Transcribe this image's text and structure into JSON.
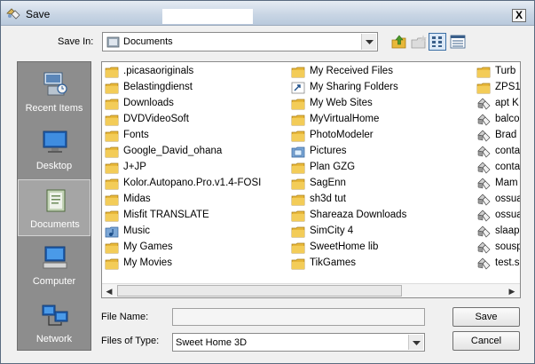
{
  "window": {
    "title": "Save",
    "close_label": "X"
  },
  "save_in": {
    "label": "Save In:",
    "value": "Documents"
  },
  "toolbar_icons": [
    "up-folder-icon",
    "new-folder-icon",
    "list-view-icon",
    "details-view-icon"
  ],
  "places": [
    {
      "label": "Recent Items",
      "icon": "recent-items-icon"
    },
    {
      "label": "Desktop",
      "icon": "desktop-icon"
    },
    {
      "label": "Documents",
      "icon": "documents-icon",
      "selected": true
    },
    {
      "label": "Computer",
      "icon": "computer-icon"
    },
    {
      "label": "Network",
      "icon": "network-icon"
    }
  ],
  "files": {
    "col1": [
      {
        "name": ".picasaoriginals",
        "type": "folder"
      },
      {
        "name": "Belastingdienst",
        "type": "folder"
      },
      {
        "name": "Downloads",
        "type": "folder"
      },
      {
        "name": "DVDVideoSoft",
        "type": "folder"
      },
      {
        "name": "Fonts",
        "type": "folder"
      },
      {
        "name": "Google_David_ohana",
        "type": "folder"
      },
      {
        "name": "J+JP",
        "type": "folder"
      },
      {
        "name": "Kolor.Autopano.Pro.v1.4-FOSI",
        "type": "folder"
      },
      {
        "name": "Midas",
        "type": "folder"
      },
      {
        "name": "Misfit TRANSLATE",
        "type": "folder"
      },
      {
        "name": "Music",
        "type": "music-folder"
      },
      {
        "name": "My Games",
        "type": "folder"
      },
      {
        "name": "My Movies",
        "type": "folder"
      }
    ],
    "col2": [
      {
        "name": "My Received Files",
        "type": "folder"
      },
      {
        "name": "My Sharing Folders",
        "type": "shortcut"
      },
      {
        "name": "My Web Sites",
        "type": "folder"
      },
      {
        "name": "MyVirtualHome",
        "type": "folder"
      },
      {
        "name": "PhotoModeler",
        "type": "folder"
      },
      {
        "name": "Pictures",
        "type": "pictures-folder"
      },
      {
        "name": "Plan GZG",
        "type": "folder"
      },
      {
        "name": "SagEnn",
        "type": "folder"
      },
      {
        "name": "sh3d tut",
        "type": "folder"
      },
      {
        "name": "Shareaza Downloads",
        "type": "folder"
      },
      {
        "name": "SimCity 4",
        "type": "folder"
      },
      {
        "name": "SweetHome lib",
        "type": "folder"
      },
      {
        "name": "TikGames",
        "type": "folder"
      }
    ],
    "col3": [
      {
        "name": "Turb",
        "type": "folder"
      },
      {
        "name": "ZPS1",
        "type": "folder"
      },
      {
        "name": "apt K",
        "type": "file"
      },
      {
        "name": "balco",
        "type": "file"
      },
      {
        "name": "Brad",
        "type": "file"
      },
      {
        "name": "conta",
        "type": "file"
      },
      {
        "name": "conta",
        "type": "file"
      },
      {
        "name": "Mam",
        "type": "file"
      },
      {
        "name": "ossua",
        "type": "file"
      },
      {
        "name": "ossua",
        "type": "file"
      },
      {
        "name": "slaap",
        "type": "file"
      },
      {
        "name": "sousp",
        "type": "file"
      },
      {
        "name": "test.s",
        "type": "file"
      }
    ]
  },
  "file_name": {
    "label": "File Name:",
    "value": ""
  },
  "files_of_type": {
    "label": "Files of Type:",
    "value": "Sweet Home 3D"
  },
  "buttons": {
    "save": "Save",
    "cancel": "Cancel"
  },
  "colors": {
    "folder": "#e8b83a",
    "places_bg": "#8d8d8d",
    "title_gradient_end": "#b9c9dc"
  }
}
